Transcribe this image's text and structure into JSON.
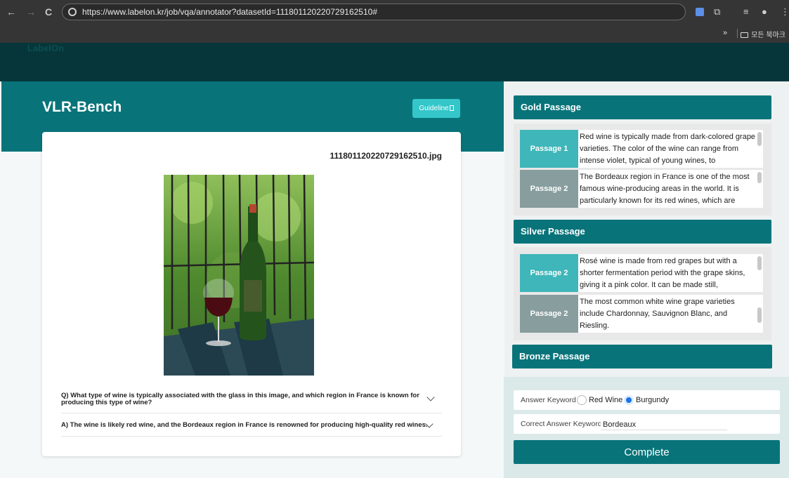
{
  "browser": {
    "back": "←",
    "forward": "→",
    "reload": "C",
    "url": "https://www.labelon.kr/job/vqa/annotator?datasetId=111801120220729162510#",
    "bookmarks_more": "»",
    "bookmarks_folder": "모든 북마크"
  },
  "header": {
    "brand": "LabelOn"
  },
  "page": {
    "title": "VLR-Bench",
    "guideline_label": "Guideline"
  },
  "card": {
    "filename": "111801120220729162510.jpg",
    "question": "Q) What type of wine is typically associated with the glass in this image, and which region in France is known for producing this type of wine?",
    "answer": "A) The wine is likely red wine, and the Bordeaux region in France is renowned for producing high-quality red wines."
  },
  "gold": {
    "title": "Gold Passage",
    "passages": [
      {
        "label": "Passage 1",
        "text": "Red wine is typically made from dark-colored grape varieties. The color of the wine can range from intense violet, typical of young wines, to"
      },
      {
        "label": "Passage 2",
        "text": "The Bordeaux region in France is one of the most famous wine-producing areas in the world. It is particularly known for its red wines, which are"
      }
    ]
  },
  "silver": {
    "title": "Silver Passage",
    "passages": [
      {
        "label": "Passage 2",
        "text": "Rosé wine is made from red grapes but with a shorter fermentation period with the grape skins, giving it a pink color. It can be made still,"
      },
      {
        "label": "Passage 2",
        "text": "The most common white wine grape varieties include Chardonnay, Sauvignon Blanc, and Riesling."
      }
    ]
  },
  "bronze": {
    "title": "Bronze Passage"
  },
  "answer_keyword": {
    "label": "Answer Keyword",
    "options": [
      "Red Wine",
      "Burgundy"
    ],
    "selected": "Burgundy"
  },
  "correct_keyword": {
    "label": "Correct Answer Keyword",
    "value": "Bordeaux"
  },
  "complete_label": "Complete",
  "colors": {
    "teal": "#08747a",
    "teal_light": "#34c6c9",
    "passage_active": "#3fb6b9",
    "passage_inactive": "#889d9d",
    "header_dark": "#06363a"
  }
}
